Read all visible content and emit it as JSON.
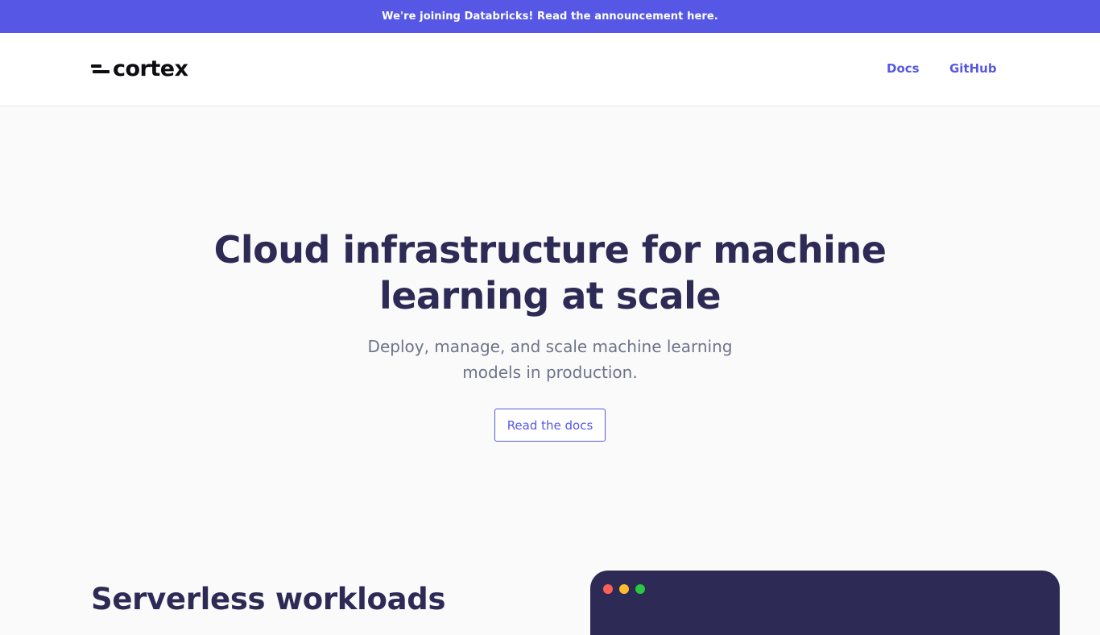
{
  "announcement": {
    "text": "We're joining Databricks! Read the announcement here."
  },
  "nav": {
    "logo_text": "cortex",
    "links": [
      {
        "label": "Docs"
      },
      {
        "label": "GitHub"
      }
    ]
  },
  "hero": {
    "title": "Cloud infrastructure for machine learning at scale",
    "subtitle": "Deploy, manage, and scale machine learning models in production.",
    "cta_label": "Read the docs"
  },
  "features": {
    "heading": "Serverless workloads"
  },
  "colors": {
    "accent": "#5658e5",
    "heading": "#2d2b55",
    "subtitle": "#6e7489",
    "terminal_bg": "#2d2b55",
    "window_red": "#fe5f57",
    "window_yellow": "#febc2e",
    "window_green": "#28c840"
  }
}
